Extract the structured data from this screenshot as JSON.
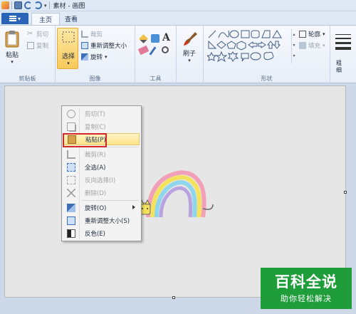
{
  "titlebar": {
    "title": "素材 - 画图"
  },
  "tabs": {
    "home": "主页",
    "view": "查看"
  },
  "clipboard": {
    "paste": "粘贴",
    "cut": "剪切",
    "copy": "复制",
    "label": "剪贴板"
  },
  "image": {
    "select": "选择",
    "crop": "裁剪",
    "resize": "重新调整大小",
    "rotate": "旋转",
    "label": "图像"
  },
  "tools": {
    "label": "工具"
  },
  "brushes": {
    "label": "刷子"
  },
  "shapes": {
    "outline": "轮廓",
    "fill": "填充",
    "label": "形状"
  },
  "size": {
    "label": "粗细"
  },
  "context_menu": [
    {
      "label": "剪切(T)",
      "state": "disabled",
      "icon": "scissors-icon"
    },
    {
      "label": "复制(C)",
      "state": "disabled",
      "icon": "copy-icon"
    },
    {
      "label": "粘贴(P)",
      "state": "hover",
      "icon": "clipboard-icon"
    },
    {
      "label": "裁剪(R)",
      "state": "disabled",
      "icon": "crop-icon"
    },
    {
      "label": "全选(A)",
      "state": "enabled",
      "icon": "select-all-icon"
    },
    {
      "label": "反向选择(I)",
      "state": "disabled",
      "icon": "invert-selection-icon"
    },
    {
      "label": "删除(D)",
      "state": "disabled",
      "icon": "delete-icon"
    },
    {
      "label": "旋转(O)",
      "state": "enabled",
      "icon": "rotate-icon"
    },
    {
      "label": "重新调整大小(S)",
      "state": "enabled",
      "icon": "resize-icon"
    },
    {
      "label": "反色(E)",
      "state": "enabled",
      "icon": "invert-color-icon"
    }
  ],
  "watermark": {
    "top": "百科全说",
    "bottom": "助你轻松解决"
  }
}
